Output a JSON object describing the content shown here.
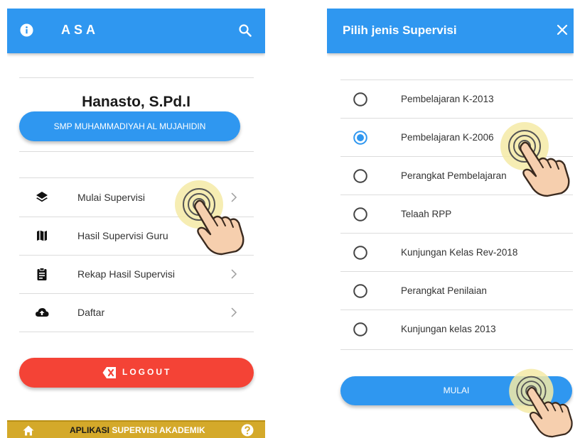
{
  "left_screen": {
    "app_title": "ASA",
    "user_name": "Hanasto, S.Pd.I",
    "school_button": "SMP MUHAMMADIYAH AL MUJAHIDIN",
    "menu": [
      {
        "label": "Mulai Supervisi",
        "icon": "layers-icon"
      },
      {
        "label": "Hasil Supervisi Guru",
        "icon": "map-icon"
      },
      {
        "label": "Rekap Hasil Supervisi",
        "icon": "clipboard-icon"
      },
      {
        "label": "Daftar",
        "icon": "cloud-upload-icon"
      }
    ],
    "logout_label": "LOGOUT",
    "footer": {
      "part1": "APLIKASI",
      "part2": "SUPERVISI AKADEMIK"
    }
  },
  "right_screen": {
    "dialog_title": "Pilih jenis Supervisi",
    "options": [
      {
        "label": "Pembelajaran K-2013",
        "selected": false
      },
      {
        "label": "Pembelajaran K-2006",
        "selected": true
      },
      {
        "label": "Perangkat Pembelajaran",
        "selected": false
      },
      {
        "label": "Telaah RPP",
        "selected": false
      },
      {
        "label": "Kunjungan Kelas Rev-2018",
        "selected": false
      },
      {
        "label": "Perangkat Penilaian",
        "selected": false
      },
      {
        "label": "Kunjungan kelas 2013",
        "selected": false
      }
    ],
    "start_button": "MULAI"
  },
  "colors": {
    "primary": "#2f97f0",
    "danger": "#f44336",
    "footer_bg": "#d4a92a",
    "tap_highlight": "#f3e9a0"
  }
}
